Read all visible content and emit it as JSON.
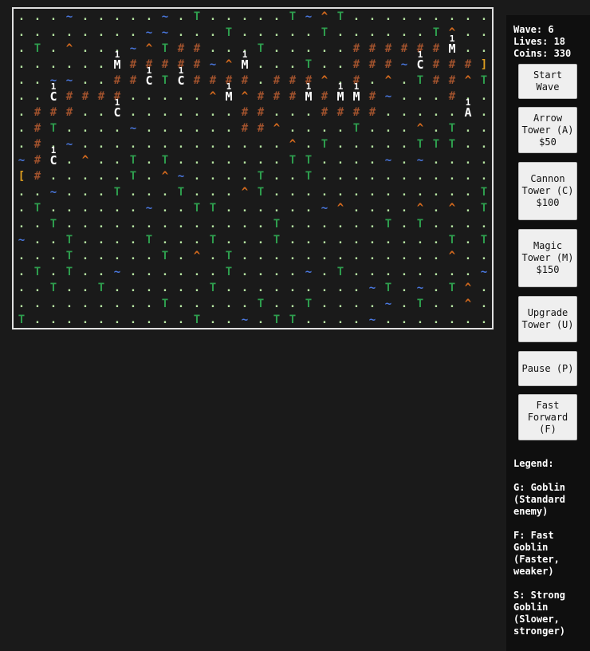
{
  "colors": {
    "background": "#1a1a1a",
    "panel": "#0f0f0f",
    "board_border": "#e0e0e0",
    "grass": "#b5e3a1",
    "tree": "#2e9e4e",
    "water": "#4a78e0",
    "mountain": "#d2691e",
    "path": "#a0522d",
    "tower": "#ffffff",
    "gate": "#e0a020"
  },
  "stats": {
    "wave": "Wave: 6",
    "lives": "Lives: 18",
    "coins": "Coins: 330"
  },
  "buttons": [
    {
      "id": "start",
      "label": "Start Wave"
    },
    {
      "id": "arrow",
      "label": "Arrow Tower (A) $50"
    },
    {
      "id": "cannon",
      "label": "Cannon Tower (C) $100"
    },
    {
      "id": "magic",
      "label": "Magic Tower (M) $150"
    },
    {
      "id": "upgrade",
      "label": "Upgrade Tower (U)"
    },
    {
      "id": "pause",
      "label": "Pause (P)"
    },
    {
      "id": "fast",
      "label": "Fast Forward (F)"
    }
  ],
  "legend": {
    "title": "Legend:",
    "items": [
      {
        "key": "G",
        "text": "G: Goblin (Standard enemy)"
      },
      {
        "key": "F",
        "text": "F: Fast Goblin (Faster, weaker)"
      },
      {
        "key": "S",
        "text": "S: Strong Goblin (Slower, stronger)"
      }
    ]
  },
  "map": [
    ". . . ~ . . . . . ~ . T . . . . . T ~ ^ T . . . . . . . . .",
    ". . . . . . . . ~ ~ . . . T . . . . . T . . . . . . T ^ . .",
    ". T . ^ . . . ~ ^ T # # . . . T . . . . . # # # # # # M . .",
    ". . . . . . M # # # # # ~ ^ M . . . T . . # # # ~ C # # # ]",
    ". . ~ ~ . . # # C T C # # # # . # # # ^ . # . ^ . T # # ^ T",
    ". . C # # # # . . . . . ^ M ^ # # # M # M M # ~ . . . # . .",
    ". # # # . . C . . . . . . . # # . . . # # # # . . . . . A .",
    ". # T . . . . ~ . . . . . . # # ^ . . . . T . . . ^ . T . .",
    ". # . ~ . . . . . . . . . . . . . ^ . T . . . . . T T T . .",
    "~ # C . ^ . . T . T . . . . . . . T T . . . . ~ . ~ . . . .",
    "[ # . . . . . T . ^ ~ . . . . T . . T . . . . . . . . . . .",
    ". . ~ . . . T . . . T . . . ^ T . . . . . . . . . . . . . T",
    ". T . . . . . . ~ . . T T . . . . . . ~ ^ . . . . ^ . ^ . T",
    ". . T . . . . . . . . . . . . . T . . . . . . T . T . . . .",
    "~ . . T . . . . T . . . T . . . T . . . . . . . . . . T . T",
    ". . . T . . . . . T . ^ . T . . . . . . . . . . . . . ^ . .",
    ". T . T . . ~ . . . . . . T . . . . ~ . T . . . . . . . . ~",
    ". . T . . T . . . . . . T . . . . . . . . . ~ T . ~ . T ^ .",
    ". . . . . . . . . T . . . . . T . . T . . . . ~ . T . . ^ .",
    "T . . . . . . . . . . T . . ~ . T T . . . . ~ . . . . . . ."
  ],
  "tower_levels": "1"
}
